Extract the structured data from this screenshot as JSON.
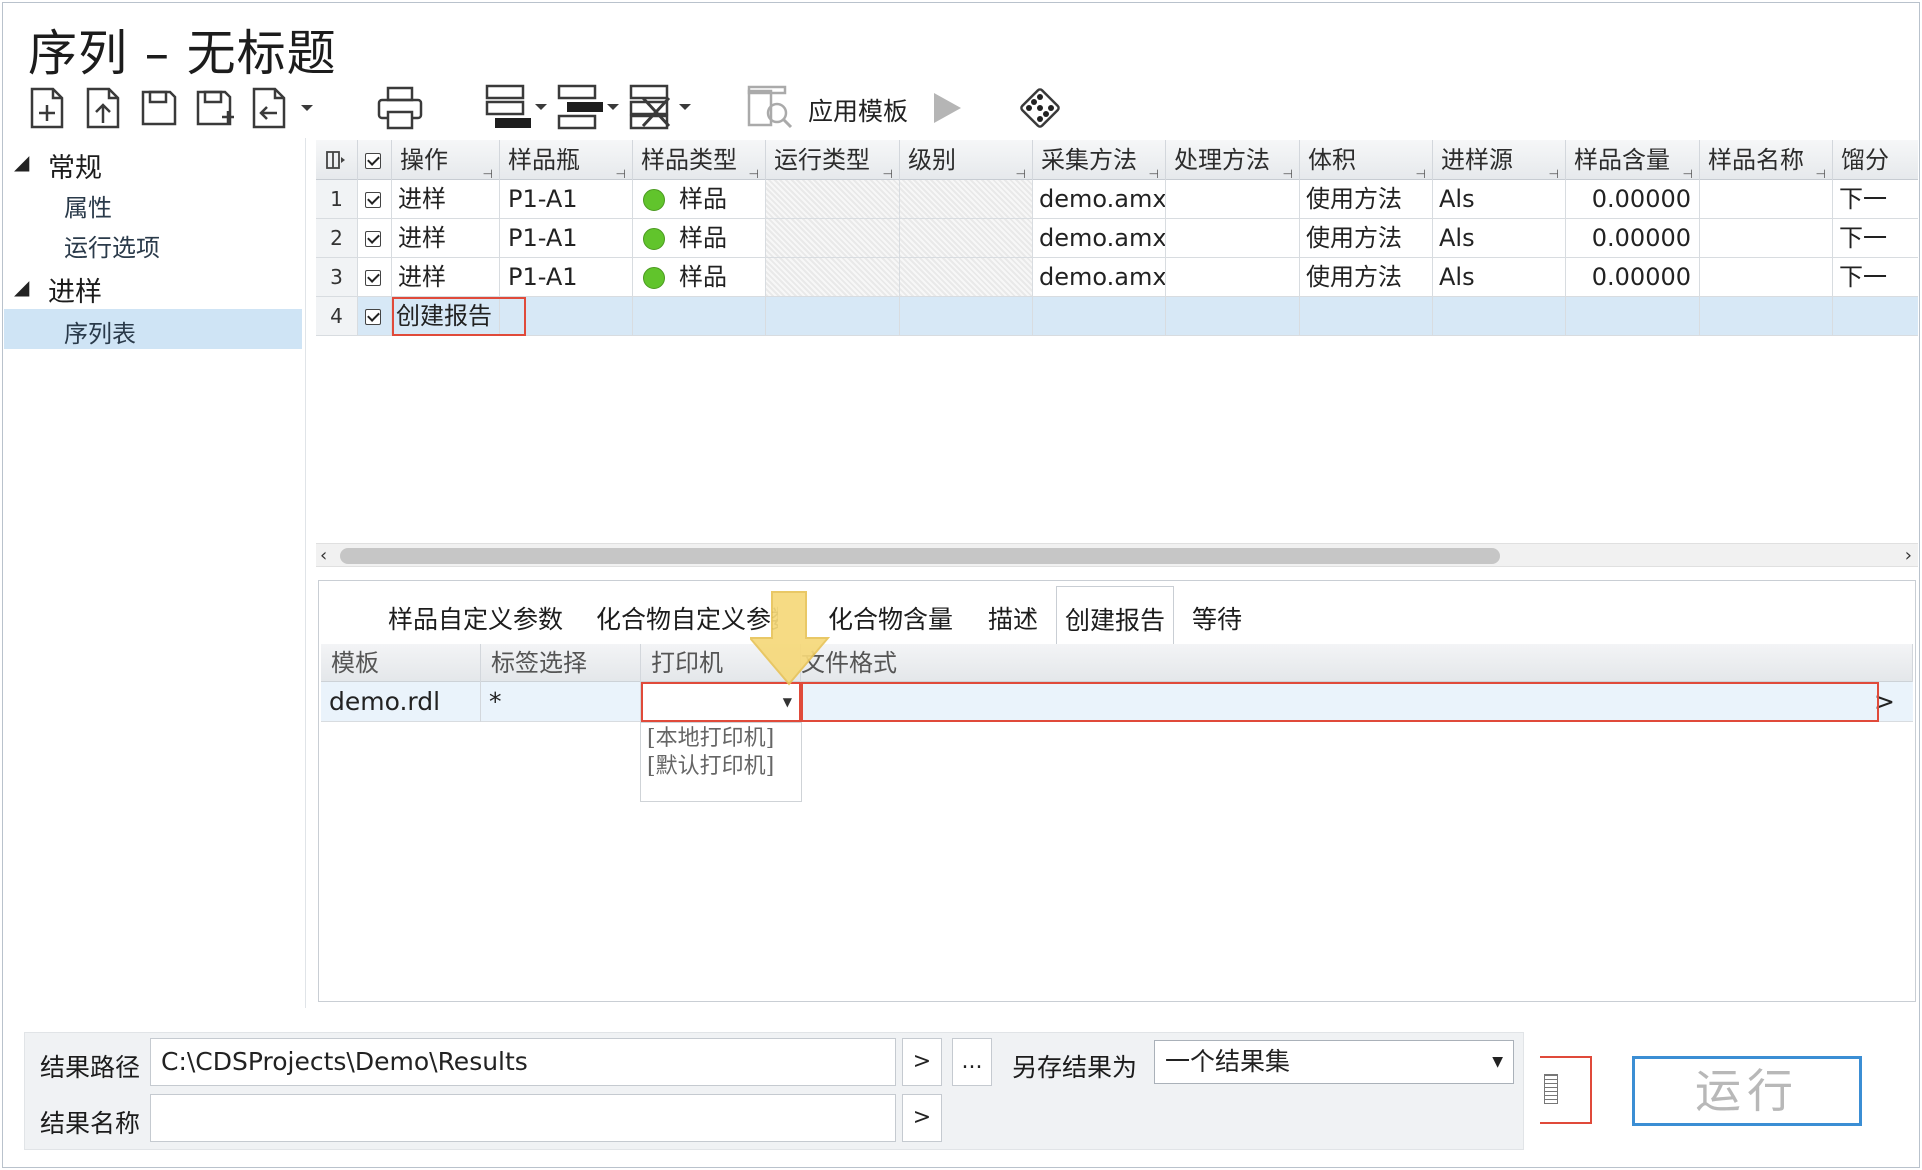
{
  "window": {
    "title": "序列 – 无标题"
  },
  "toolbar": {
    "apply_template_label": "应用模板"
  },
  "nav": {
    "groups": [
      {
        "label": "常规",
        "items": [
          "属性",
          "运行选项"
        ]
      },
      {
        "label": "进样",
        "items": [
          "序列表"
        ]
      }
    ],
    "selected": "序列表"
  },
  "grid": {
    "headers": [
      "操作",
      "样品瓶",
      "样品类型",
      "运行类型",
      "级别",
      "采集方法",
      "处理方法",
      "体积",
      "进样源",
      "样品含量",
      "样品名称",
      "馏分"
    ],
    "rows": [
      {
        "num": "1",
        "action": "进样",
        "vial": "P1-A1",
        "sample_type": "样品",
        "acq": "demo.amx",
        "volume": "使用方法",
        "source": "Als",
        "amount": "0.00000",
        "frac": "下一"
      },
      {
        "num": "2",
        "action": "进样",
        "vial": "P1-A1",
        "sample_type": "样品",
        "acq": "demo.amx",
        "volume": "使用方法",
        "source": "Als",
        "amount": "0.00000",
        "frac": "下一"
      },
      {
        "num": "3",
        "action": "进样",
        "vial": "P1-A1",
        "sample_type": "样品",
        "acq": "demo.amx",
        "volume": "使用方法",
        "source": "Als",
        "amount": "0.00000",
        "frac": "下一"
      },
      {
        "num": "4",
        "action": "创建报告"
      }
    ]
  },
  "tabs": [
    "样品自定义参数",
    "化合物自定义参数",
    "化合物含量",
    "描述",
    "创建报告",
    "等待"
  ],
  "active_tab": "创建报告",
  "report_grid": {
    "headers": [
      "模板",
      "标签选择",
      "打印机",
      "文件格式"
    ],
    "row": {
      "template": "demo.rdl",
      "label": "*",
      "printer": "",
      "format": ""
    },
    "printer_options": [
      "[本地打印机]",
      "[默认打印机]"
    ],
    "more": ">"
  },
  "footer": {
    "result_path_label": "结果路径",
    "result_path": "C:\\CDSProjects\\Demo\\Results",
    "result_name_label": "结果名称",
    "result_name": "",
    "browse": ">",
    "ellipsis": "...",
    "save_as_label": "另存结果为",
    "save_as_value": "一个结果集",
    "run_label": "运行"
  },
  "colors": {
    "accent": "#3b8ed4",
    "highlight": "#e04a3a",
    "selection": "#cfe4f5",
    "annotation_arrow": "#f6d97a"
  }
}
